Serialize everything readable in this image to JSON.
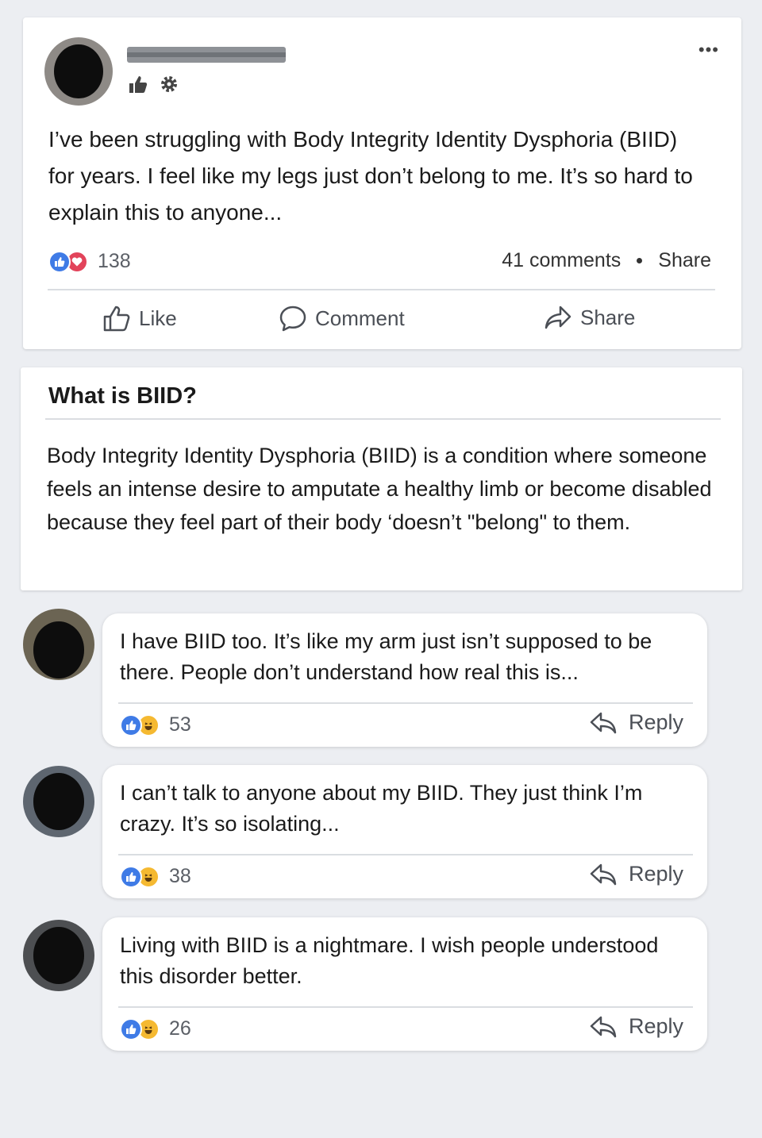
{
  "post": {
    "menu_label": "•••",
    "text": "I’ve been struggling with Body Integrity Identity Dysphoria (BIID) for years. I feel like my legs just don’t belong to me. It’s so hard to explain this to anyone...",
    "reaction_count": "138",
    "comments_count": "41 comments",
    "share_count_label": "Share",
    "actions": {
      "like": "Like",
      "comment": "Comment",
      "share": "Share"
    }
  },
  "info": {
    "title": "What is BIID?",
    "body": "Body Integrity Identity Dysphoria (BIID) is a condition where someone  feels an intense desire to amputate a healthy limb or become disabled because they feel part of their body ‘doesn’t \"belong\" to them."
  },
  "comments": [
    {
      "text": "I have BIID too. It’s like my arm just isn’t supposed to be there. People don’t understand how real this is...",
      "reaction_count": "53",
      "reply_label": "Reply"
    },
    {
      "text": "I can’t talk to anyone about my BIID. They just think I’m crazy. It’s so isolating...",
      "reaction_count": "38",
      "reply_label": "Reply"
    },
    {
      "text": "Living with BIID is a nightmare. I wish people understood this disorder better.",
      "reaction_count": "26",
      "reply_label": "Reply"
    }
  ],
  "colors": {
    "like": "#3f7be6",
    "love": "#e2435a",
    "haha": "#f5b931",
    "background": "#eceef2"
  },
  "icons": [
    "thumbs-up-icon",
    "gear-icon",
    "like-reaction-icon",
    "love-reaction-icon",
    "haha-reaction-icon",
    "comment-icon",
    "share-icon",
    "reply-icon",
    "more-icon"
  ]
}
